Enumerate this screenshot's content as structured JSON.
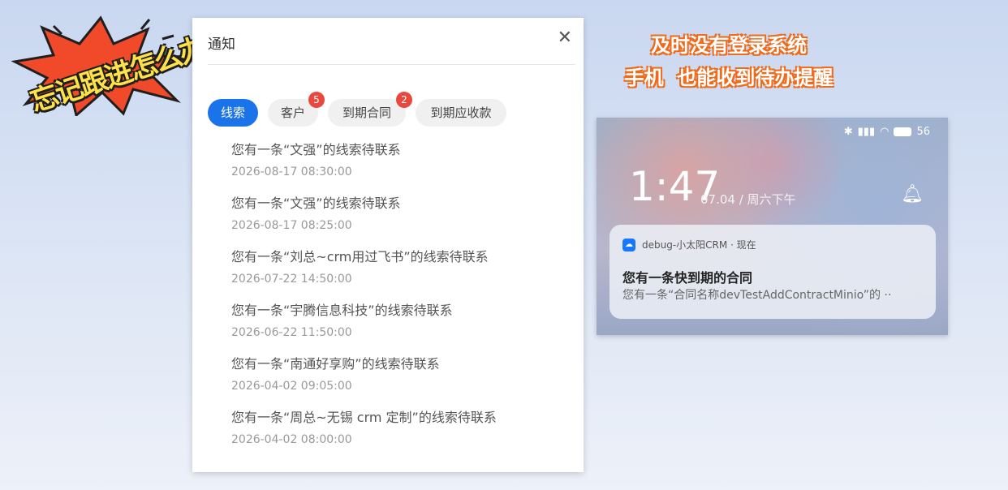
{
  "sticker": {
    "text": "忘记跟进怎么办?"
  },
  "panel": {
    "title": "通知",
    "close_symbol": "✕",
    "tabs": [
      {
        "label": "线索",
        "badge": ""
      },
      {
        "label": "客户",
        "badge": "5"
      },
      {
        "label": "到期合同",
        "badge": "2"
      },
      {
        "label": "到期应收款",
        "badge": ""
      }
    ],
    "items": [
      {
        "title": "您有一条“文强”的线索待联系",
        "time": "2026-08-17 08:30:00"
      },
      {
        "title": "您有一条“文强”的线索待联系",
        "time": "2026-08-17 08:25:00"
      },
      {
        "title": "您有一条“刘总~crm用过飞书”的线索待联系",
        "time": "2026-07-22 14:50:00"
      },
      {
        "title": "您有一条“宇腾信息科技”的线索待联系",
        "time": "2026-06-22 11:50:00"
      },
      {
        "title": "您有一条“南通好享购”的线索待联系",
        "time": "2026-04-02 09:05:00"
      },
      {
        "title": "您有一条“周总~无锡 crm 定制”的线索待联系",
        "time": "2026-04-02 08:00:00"
      }
    ]
  },
  "caption": {
    "line1": "及时没有登录系统",
    "line2": "手机  也能收到待办提醒"
  },
  "phone": {
    "battery": "56",
    "clock": "1:47",
    "date": "07.04 / 周六下午",
    "notification": {
      "app": "debug-小太阳CRM · 现在",
      "title": "您有一条快到期的合同",
      "body": "您有一条“合同名称devTestAddContractMinio”的 ··"
    }
  },
  "colors": {
    "accent": "#1a73e8",
    "badge": "#e8483e",
    "caption_outline": "#f06a1a"
  }
}
